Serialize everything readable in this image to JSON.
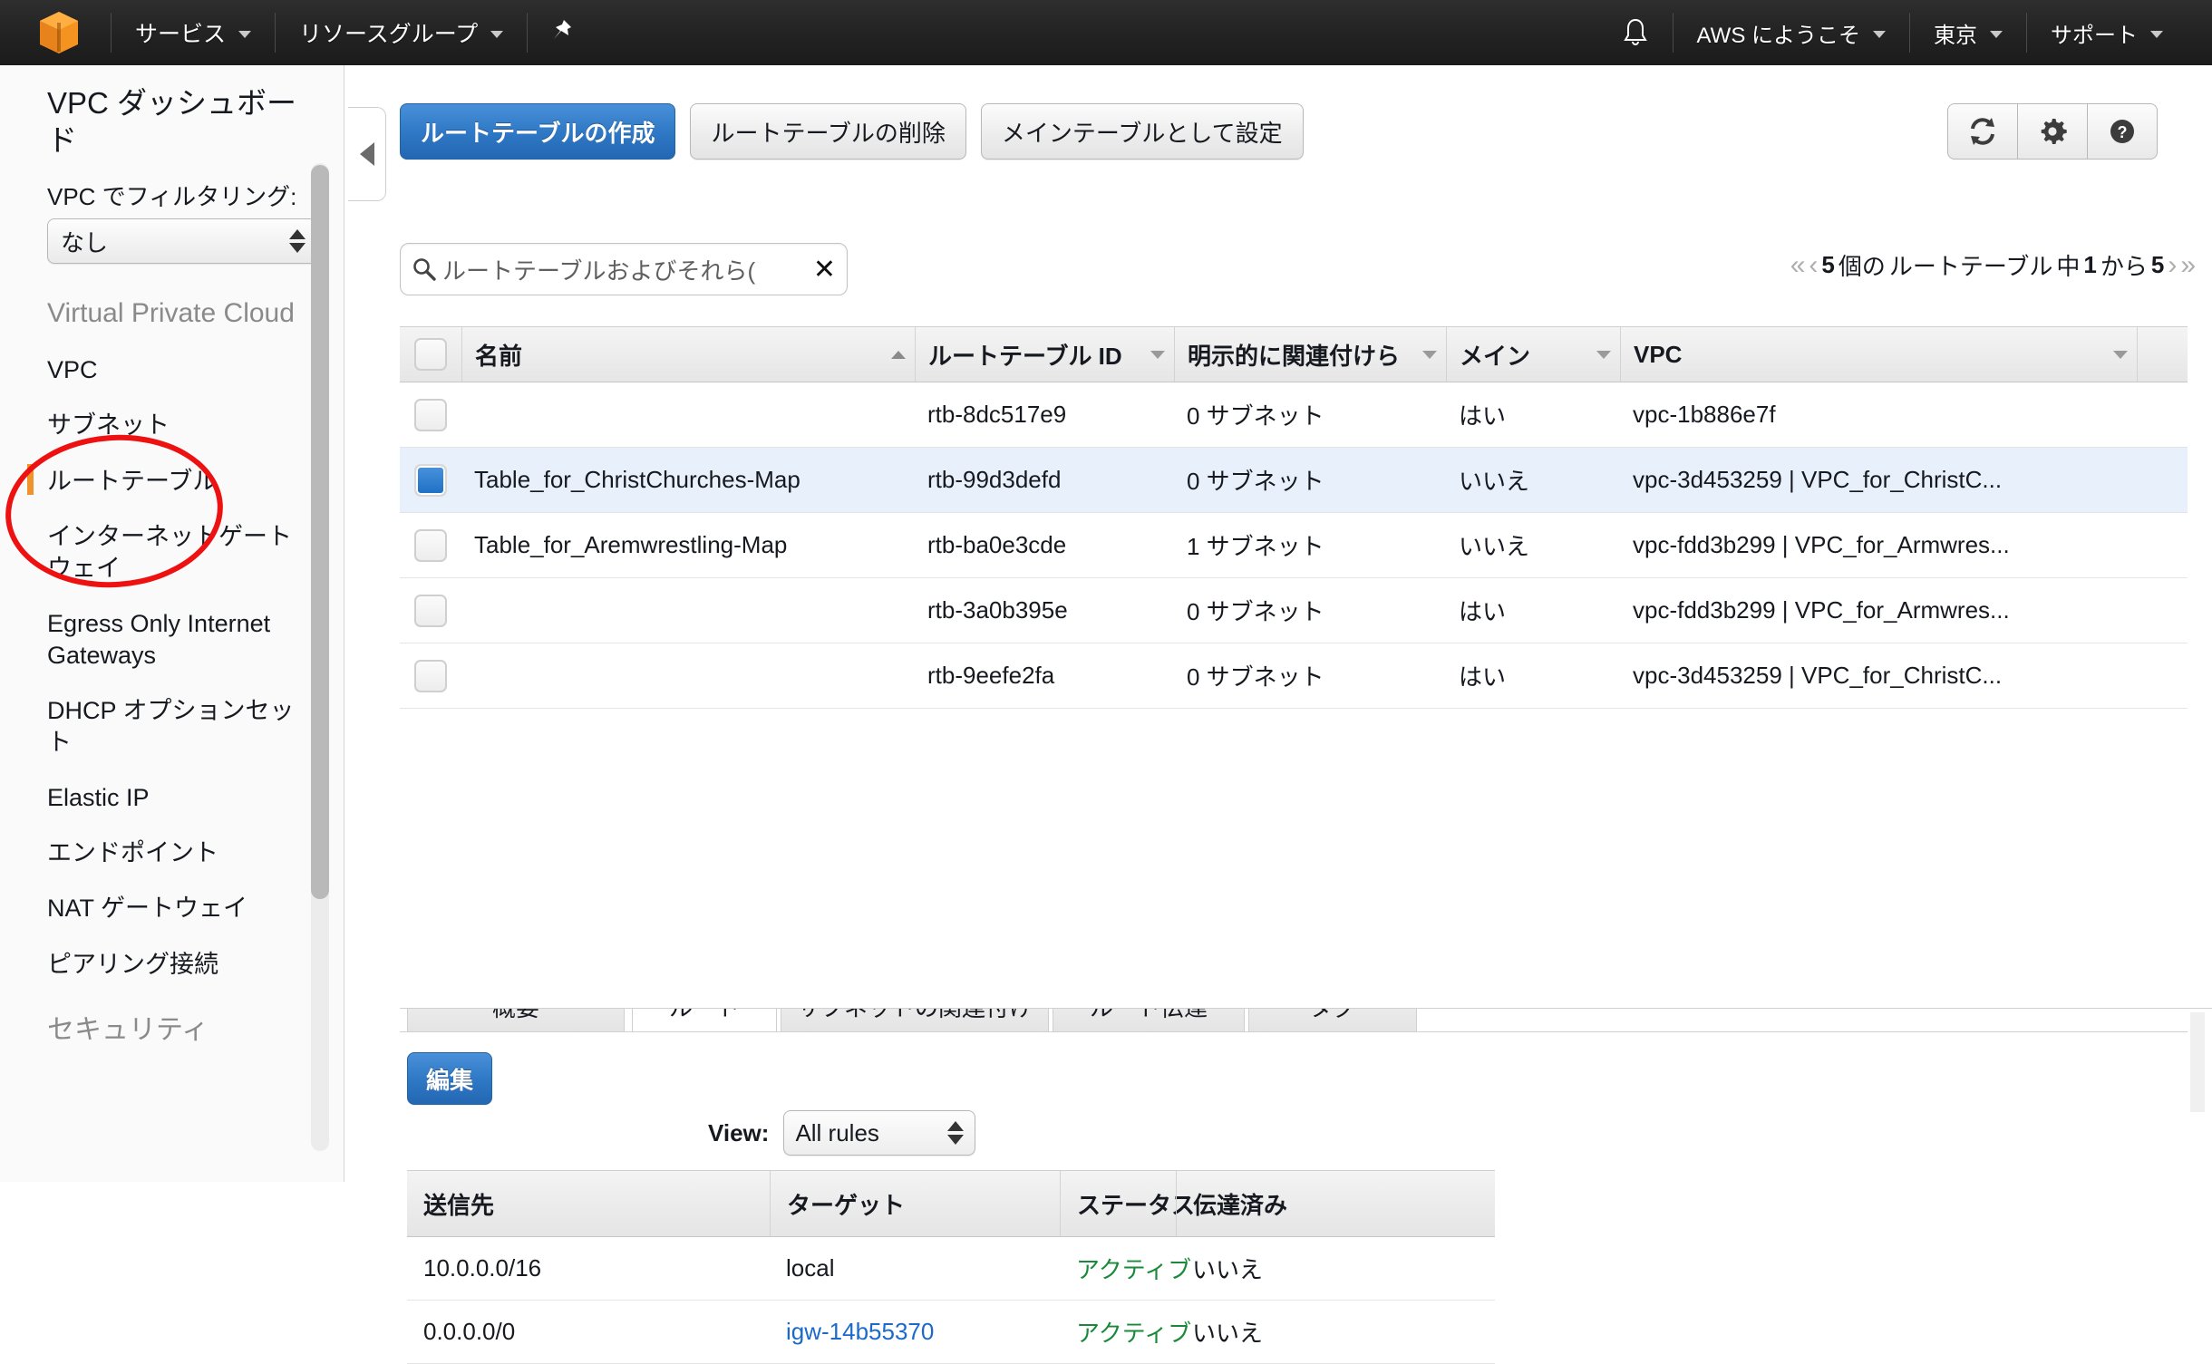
{
  "topnav": {
    "logo_icon": "aws-cube-logo",
    "services_label": "サービス",
    "resource_groups_label": "リソースグループ",
    "pin_icon": "pin-icon",
    "bell_icon": "bell-icon",
    "account_label": "AWS にようこそ",
    "region_label": "東京",
    "support_label": "サポート"
  },
  "sidebar": {
    "dashboard_title": "VPC ダッシュボード",
    "filter_label": "VPC でフィルタリング:",
    "filter_value": "なし",
    "group_vpc": "Virtual Private Cloud",
    "group_security": "セキュリティ",
    "items": [
      {
        "label": "VPC"
      },
      {
        "label": "サブネット"
      },
      {
        "label": "ルートテーブル"
      },
      {
        "label": "インターネットゲートウェイ"
      },
      {
        "label": "Egress Only Internet Gateways"
      },
      {
        "label": "DHCP オプションセット"
      },
      {
        "label": "Elastic IP"
      },
      {
        "label": "エンドポイント"
      },
      {
        "label": "NAT ゲートウェイ"
      },
      {
        "label": "ピアリング接続"
      }
    ]
  },
  "toolbar": {
    "create_label": "ルートテーブルの作成",
    "delete_label": "ルートテーブルの削除",
    "set_main_label": "メインテーブルとして設定",
    "refresh_icon": "refresh-icon",
    "gear_icon": "gear-icon",
    "help_icon": "help-icon"
  },
  "search": {
    "icon": "search-icon",
    "placeholder": "ルートテーブルおよびそれら(",
    "clear_icon": "clear-icon"
  },
  "pagination": {
    "first_icon": "«",
    "prev_icon": "‹",
    "count": "5",
    "text_of": "個の",
    "entity": "ルートテーブル",
    "text_mid": "中",
    "from": "1",
    "text_from": "から",
    "to": "5",
    "next_icon": "›",
    "last_icon": "»"
  },
  "route_tables": {
    "columns": [
      {
        "label": "名前",
        "sort": "asc"
      },
      {
        "label": "ルートテーブル ID",
        "sort": "none"
      },
      {
        "label": "明示的に関連付けら",
        "sort": "none"
      },
      {
        "label": "メイン",
        "sort": "none"
      },
      {
        "label": "VPC",
        "sort": "none"
      }
    ],
    "rows": [
      {
        "checked": false,
        "name": "",
        "id": "rtb-8dc517e9",
        "assoc": "0 サブネット",
        "main": "はい",
        "vpc": "vpc-1b886e7f"
      },
      {
        "checked": true,
        "name": "Table_for_ChristChurches-Map",
        "id": "rtb-99d3defd",
        "assoc": "0 サブネット",
        "main": "いいえ",
        "vpc": "vpc-3d453259 | VPC_for_ChristC..."
      },
      {
        "checked": false,
        "name": "Table_for_Aremwrestling-Map",
        "id": "rtb-ba0e3cde",
        "assoc": "1 サブネット",
        "main": "いいえ",
        "vpc": "vpc-fdd3b299 | VPC_for_Armwres..."
      },
      {
        "checked": false,
        "name": "",
        "id": "rtb-3a0b395e",
        "assoc": "0 サブネット",
        "main": "はい",
        "vpc": "vpc-fdd3b299 | VPC_for_Armwres..."
      },
      {
        "checked": false,
        "name": "",
        "id": "rtb-9eefe2fa",
        "assoc": "0 サブネット",
        "main": "はい",
        "vpc": "vpc-3d453259 | VPC_for_ChristC..."
      }
    ]
  },
  "detail": {
    "tabs": [
      {
        "label": "概要",
        "active": false
      },
      {
        "label": "ルート",
        "active": true
      },
      {
        "label": "サブネットの関連付け",
        "active": false
      },
      {
        "label": "ルート伝達",
        "active": false
      },
      {
        "label": "タグ",
        "active": false
      }
    ],
    "edit_label": "編集",
    "view_label": "View:",
    "view_value": "All rules",
    "routes": {
      "columns": [
        "送信先",
        "ターゲット",
        "ステータス",
        "伝達済み"
      ],
      "rows": [
        {
          "dest": "10.0.0.0/16",
          "target": "local",
          "target_link": false,
          "status": "アクティブ",
          "propagated": "いいえ"
        },
        {
          "dest": "0.0.0.0/0",
          "target": "igw-14b55370",
          "target_link": true,
          "status": "アクティブ",
          "propagated": "いいえ"
        }
      ]
    }
  },
  "annotation": {
    "ellipse_color": "#ee1111"
  },
  "colors": {
    "primary_button": "#2f79c6",
    "selected_row": "#e8f1fb",
    "active_status": "#1a8a3a",
    "link": "#1b6ac9",
    "accent_bar": "#f0932a",
    "logo_orange": "#f59321"
  }
}
